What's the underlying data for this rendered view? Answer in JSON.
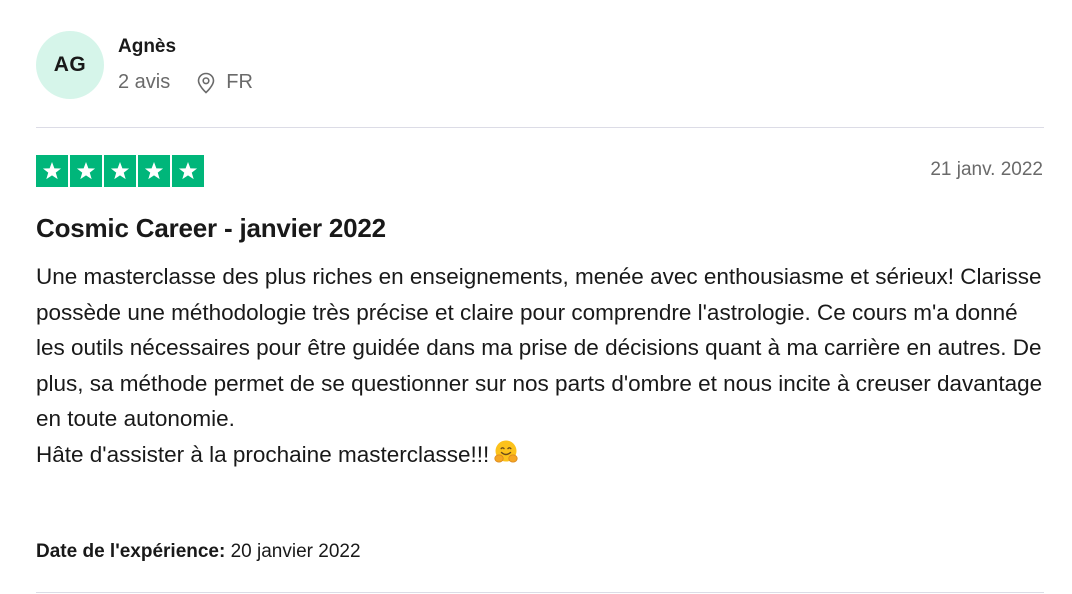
{
  "reviewer": {
    "initials": "AG",
    "name": "Agnès",
    "review_count": "2 avis",
    "country": "FR",
    "avatar_color": "#d6f5ea"
  },
  "review": {
    "rating": 5,
    "rating_max": 5,
    "star_color": "#00b67a",
    "date": "21 janv. 2022",
    "title": "Cosmic Career - janvier 2022",
    "body_paragraph_1": "Une masterclasse des plus riches en enseignements, menée avec enthousiasme et sérieux! Clarisse possède une méthodologie très précise et claire pour comprendre l'astrologie. Ce cours m'a donné les outils nécessaires pour être guidée dans ma prise de décisions quant à ma carrière en autres. De plus, sa méthode permet de se questionner sur nos parts d'ombre et nous incite à creuser davantage en toute autonomie.",
    "body_paragraph_2": "Hâte d'assister à la prochaine masterclasse!!!",
    "emoji_icon": "hugging-face-icon",
    "experience_label": "Date de l'expérience:",
    "experience_date": "20 janvier 2022"
  },
  "icons": {
    "location": "location-pin-icon",
    "star": "star-icon"
  }
}
